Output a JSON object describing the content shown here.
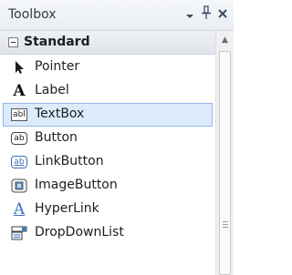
{
  "window": {
    "title": "Toolbox",
    "buttons": {
      "dropdown": "▾",
      "pin": "ᵻ",
      "close": "✕"
    }
  },
  "category": {
    "label": "Standard",
    "expanded": true
  },
  "items": [
    {
      "label": "Pointer",
      "icon": "pointer-icon"
    },
    {
      "label": "Label",
      "icon": "label-icon"
    },
    {
      "label": "TextBox",
      "icon": "textbox-icon",
      "selected": true
    },
    {
      "label": "Button",
      "icon": "button-icon"
    },
    {
      "label": "LinkButton",
      "icon": "linkbutton-icon"
    },
    {
      "label": "ImageButton",
      "icon": "imagebutton-icon"
    },
    {
      "label": "HyperLink",
      "icon": "hyperlink-icon"
    },
    {
      "label": "DropDownList",
      "icon": "dropdownlist-icon"
    }
  ],
  "icon_text": {
    "label": "A",
    "textbox": "abl",
    "button": "ab",
    "linkbutton": "ab",
    "hyperlink": "A"
  },
  "colors": {
    "selection_bg": "#dcebfb",
    "selection_border": "#8fb7e6",
    "link_blue": "#3b6fb6"
  }
}
